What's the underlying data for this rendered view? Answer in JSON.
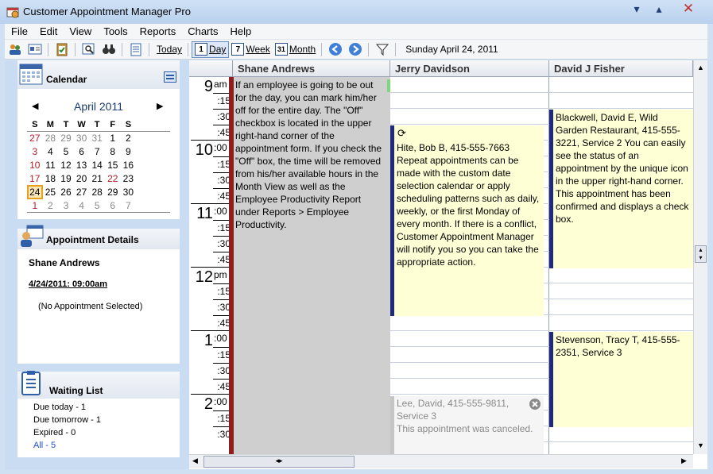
{
  "window": {
    "title": "Customer Appointment Manager Pro"
  },
  "menu": [
    "File",
    "Edit",
    "View",
    "Tools",
    "Reports",
    "Charts",
    "Help"
  ],
  "toolbar": {
    "today": "Today",
    "day": "Day",
    "week": "Week",
    "month": "Month",
    "date": "Sunday April 24, 2011",
    "week_icon_num": "7",
    "month_icon_num": "31",
    "day_icon_num": "1"
  },
  "calendar": {
    "title": "Calendar",
    "month": "April 2011",
    "dow": [
      "S",
      "M",
      "T",
      "W",
      "T",
      "F",
      "S"
    ],
    "weeks": [
      [
        "27",
        "28",
        "29",
        "30",
        "31",
        "1",
        "2"
      ],
      [
        "3",
        "4",
        "5",
        "6",
        "7",
        "8",
        "9"
      ],
      [
        "10",
        "11",
        "12",
        "13",
        "14",
        "15",
        "16"
      ],
      [
        "17",
        "18",
        "19",
        "20",
        "21",
        "22",
        "23"
      ],
      [
        "24",
        "25",
        "26",
        "27",
        "28",
        "29",
        "30"
      ],
      [
        "1",
        "2",
        "3",
        "4",
        "5",
        "6",
        "7"
      ]
    ]
  },
  "details": {
    "title": "Appointment Details",
    "name": "Shane Andrews",
    "datetime": "4/24/2011: 09:00am",
    "none": "(No Appointment Selected)"
  },
  "waiting": {
    "title": "Waiting List",
    "due_today": "Due today - 1",
    "due_tomorrow": "Due tomorrow - 1",
    "expired": "Expired - 0",
    "all": "All - 5"
  },
  "schedule": {
    "employees": [
      "Shane Andrews",
      "Jerry Davidson",
      "David J Fisher"
    ],
    "hours": [
      {
        "h": "9",
        "suffix": "am",
        "mins": [
          "15",
          "30",
          "45"
        ]
      },
      {
        "h": "10",
        "suffix": ":00",
        "mins": [
          "15",
          "30",
          "45"
        ]
      },
      {
        "h": "11",
        "suffix": ":00",
        "mins": [
          "15",
          "30",
          "45"
        ]
      },
      {
        "h": "12",
        "suffix": "pm",
        "mins": [
          "15",
          "30",
          "45"
        ]
      },
      {
        "h": "1",
        "suffix": ":00",
        "mins": [
          "15",
          "30",
          "45"
        ]
      },
      {
        "h": "2",
        "suffix": ":00",
        "mins": [
          "15",
          "30"
        ]
      }
    ],
    "off_note": "If an employee is going to be out for the day, you can mark him/her off for the entire day. The \"Off\" checkbox is located in the upper right-hand corner of the appointment form. If you check the \"Off\" box, the time will be removed from his/her available hours in the Month View as well as the Employee Productivity Report under Reports > Employee Productivity.",
    "appt_hite": "Hite, Bob B, 415-555-7663 Repeat appointments can be made with the custom date selection calendar or apply scheduling patterns such as daily, weekly, or the first Monday of every month. If there is a conflict, Customer Appointment Manager will notify you so you can take the appropriate action.",
    "appt_blackwell": "Blackwell, David E, Wild Garden Restaurant, 415-555-3221, Service 2 You can easily see the status of an appointment by the unique icon in the upper right-hand corner. This appointment has been confirmed and displays a check box.",
    "appt_stevenson": "Stevenson, Tracy T, 415-555-2351, Service 3",
    "appt_lee": "Lee, David, 415-555-9811, Service 3",
    "appt_lee_note": "This appointment was canceled."
  }
}
